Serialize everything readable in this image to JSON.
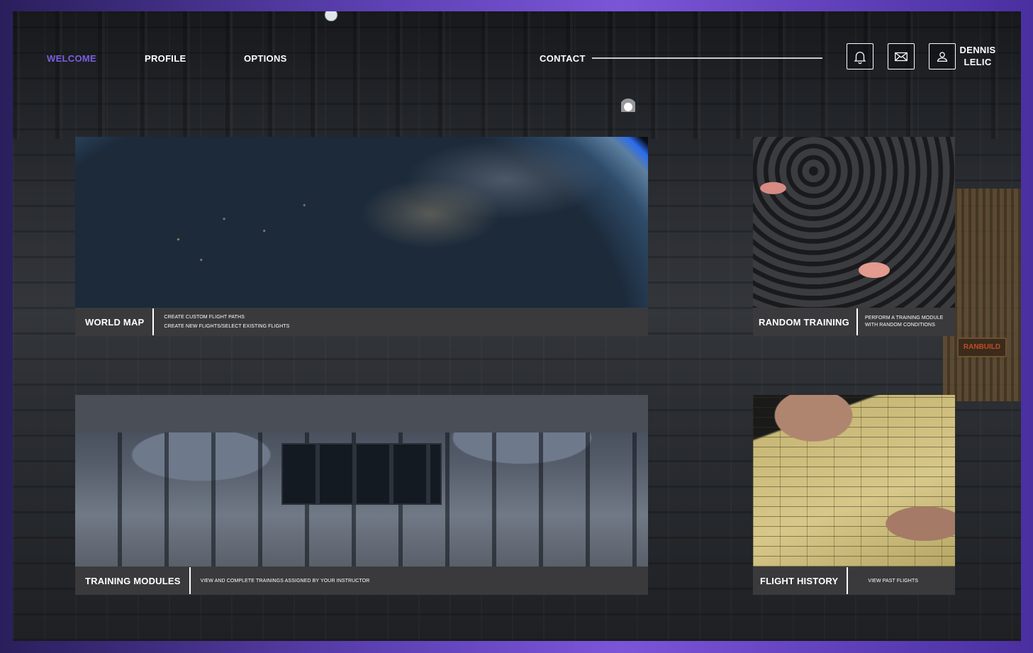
{
  "nav": {
    "items": [
      {
        "label": "WELCOME",
        "active": true
      },
      {
        "label": "PROFILE",
        "active": false
      },
      {
        "label": "OPTIONS",
        "active": false
      },
      {
        "label": "CONTACT",
        "active": false
      }
    ],
    "accent": "#7b5fe0"
  },
  "header": {
    "icons": [
      "bell-icon",
      "mail-icon",
      "user-icon"
    ],
    "user": {
      "first_name": "DENNIS",
      "last_name": "LELIC"
    }
  },
  "cards": {
    "world_map": {
      "title": "WORLD MAP",
      "desc": [
        "CREATE CUSTOM FLIGHT PATHS",
        "CREATE NEW FLIGHTS/SELECT EXISTING FLIGHTS"
      ]
    },
    "random_training": {
      "title": "RANDOM TRAINING",
      "desc": [
        "PERFORM A TRAINING MODULE",
        "WITH RANDOM CONDITIONS"
      ]
    },
    "training_modules": {
      "title": "TRAINING MODULES",
      "desc": [
        "VIEW AND COMPLETE TRAININGS ASSIGNED BY YOUR INSTRUCTOR"
      ]
    },
    "flight_history": {
      "title": "FLIGHT HISTORY",
      "desc": [
        "VIEW PAST FLIGHTS"
      ]
    }
  },
  "background": {
    "sign_text": "RANBUILD"
  }
}
